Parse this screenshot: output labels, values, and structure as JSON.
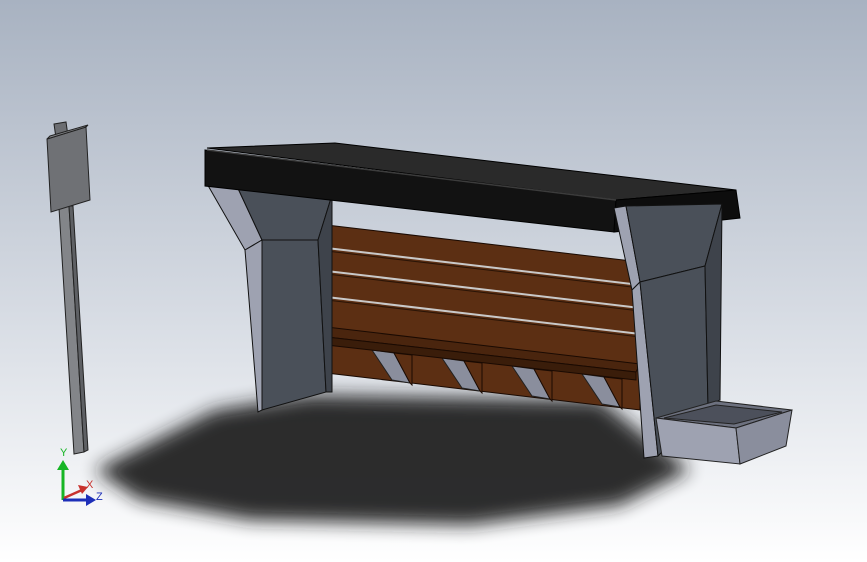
{
  "viewport": {
    "background_top": "#a9b3c2",
    "background_bottom": "#ffffff"
  },
  "triad": {
    "y_label": "Y",
    "x_label": "X",
    "z_label": "Z",
    "y_color": "#16b524",
    "x_color": "#c8322d",
    "z_color": "#1d2fb8"
  },
  "model": {
    "roof_color": "#121212",
    "support_color": "#4a5059",
    "wood_color": "#5c2f13",
    "seat_color": "#4a250e",
    "planter_color": "#8a8e9d",
    "sign_color": "#7a7c80"
  }
}
